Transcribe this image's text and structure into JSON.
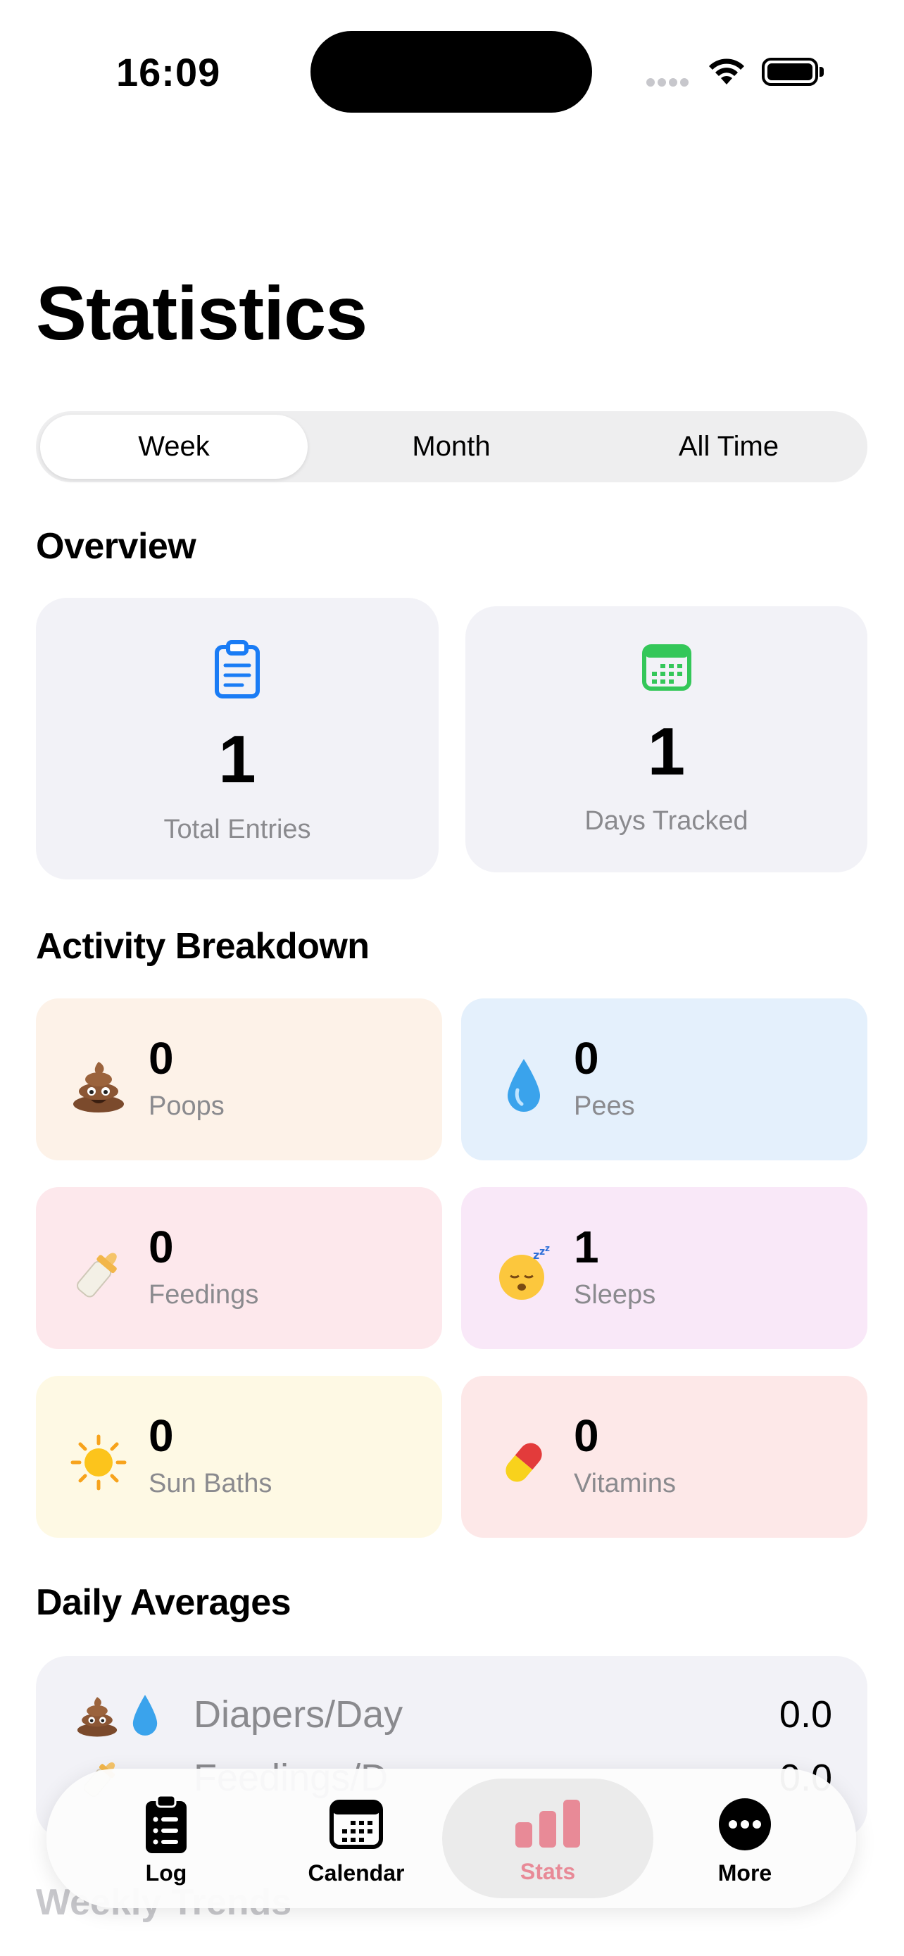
{
  "status_bar": {
    "time": "16:09"
  },
  "page_title": "Statistics",
  "segmented": {
    "options": [
      "Week",
      "Month",
      "All Time"
    ],
    "selected": "Week"
  },
  "overview": {
    "title": "Overview",
    "cards": [
      {
        "icon": "clipboard-icon",
        "value": "1",
        "label": "Total Entries",
        "color": "#1a7cf5"
      },
      {
        "icon": "calendar-icon",
        "value": "1",
        "label": "Days Tracked",
        "color": "#34c759"
      }
    ]
  },
  "activity": {
    "title": "Activity Breakdown",
    "cards": [
      {
        "icon": "poop-icon",
        "value": "0",
        "label": "Poops",
        "bg": "#fdf2e8"
      },
      {
        "icon": "droplet-icon",
        "value": "0",
        "label": "Pees",
        "bg": "#e4f0fc"
      },
      {
        "icon": "baby-bottle-icon",
        "value": "0",
        "label": "Feedings",
        "bg": "#fde8ec"
      },
      {
        "icon": "sleeping-face-icon",
        "value": "1",
        "label": "Sleeps",
        "bg": "#f9e8f8"
      },
      {
        "icon": "sun-icon",
        "value": "0",
        "label": "Sun Baths",
        "bg": "#fef9e4"
      },
      {
        "icon": "pill-icon",
        "value": "0",
        "label": "Vitamins",
        "bg": "#fde8e8"
      }
    ]
  },
  "daily_averages": {
    "title": "Daily Averages",
    "rows": [
      {
        "label": "Diapers/Day",
        "value": "0.0"
      },
      {
        "label": "Feedings/D",
        "value": "0.0"
      }
    ]
  },
  "weekly_trends": {
    "title": "Weekly Trends"
  },
  "tabbar": {
    "tabs": [
      {
        "label": "Log",
        "icon": "list-clipboard-icon"
      },
      {
        "label": "Calendar",
        "icon": "calendar-icon"
      },
      {
        "label": "Stats",
        "icon": "bar-chart-icon"
      },
      {
        "label": "More",
        "icon": "ellipsis-circle-icon"
      }
    ],
    "active": "Stats",
    "accent": "#e88a97"
  }
}
